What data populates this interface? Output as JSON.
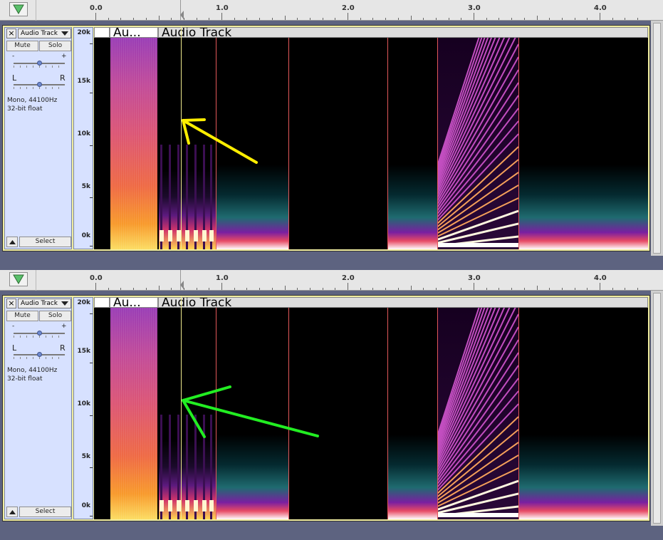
{
  "ruler": {
    "labels": [
      "0.0",
      "1.0",
      "2.0",
      "3.0",
      "4.0"
    ]
  },
  "track": {
    "name": "Audio Track",
    "close_label": "×",
    "mute_label": "Mute",
    "solo_label": "Solo",
    "gain_minus": "-",
    "gain_plus": "+",
    "pan_left": "L",
    "pan_right": "R",
    "format": "Mono, 44100Hz",
    "bits": "32-bit float",
    "select_label": "Select",
    "scale_labels": [
      "20k",
      "15k",
      "10k",
      "5k",
      "0k"
    ],
    "clip_title_short": "Au...",
    "clip_title": "Audio Track"
  },
  "panels": [
    {
      "id": "top",
      "annotation_color": "#ffee00"
    },
    {
      "id": "bottom",
      "annotation_color": "#22ee22"
    }
  ],
  "colors": {
    "track_bg": "#d7e1ff",
    "selection": "#f0eda0",
    "clip_boundary": "#e2585a",
    "background": "#5d6380"
  }
}
